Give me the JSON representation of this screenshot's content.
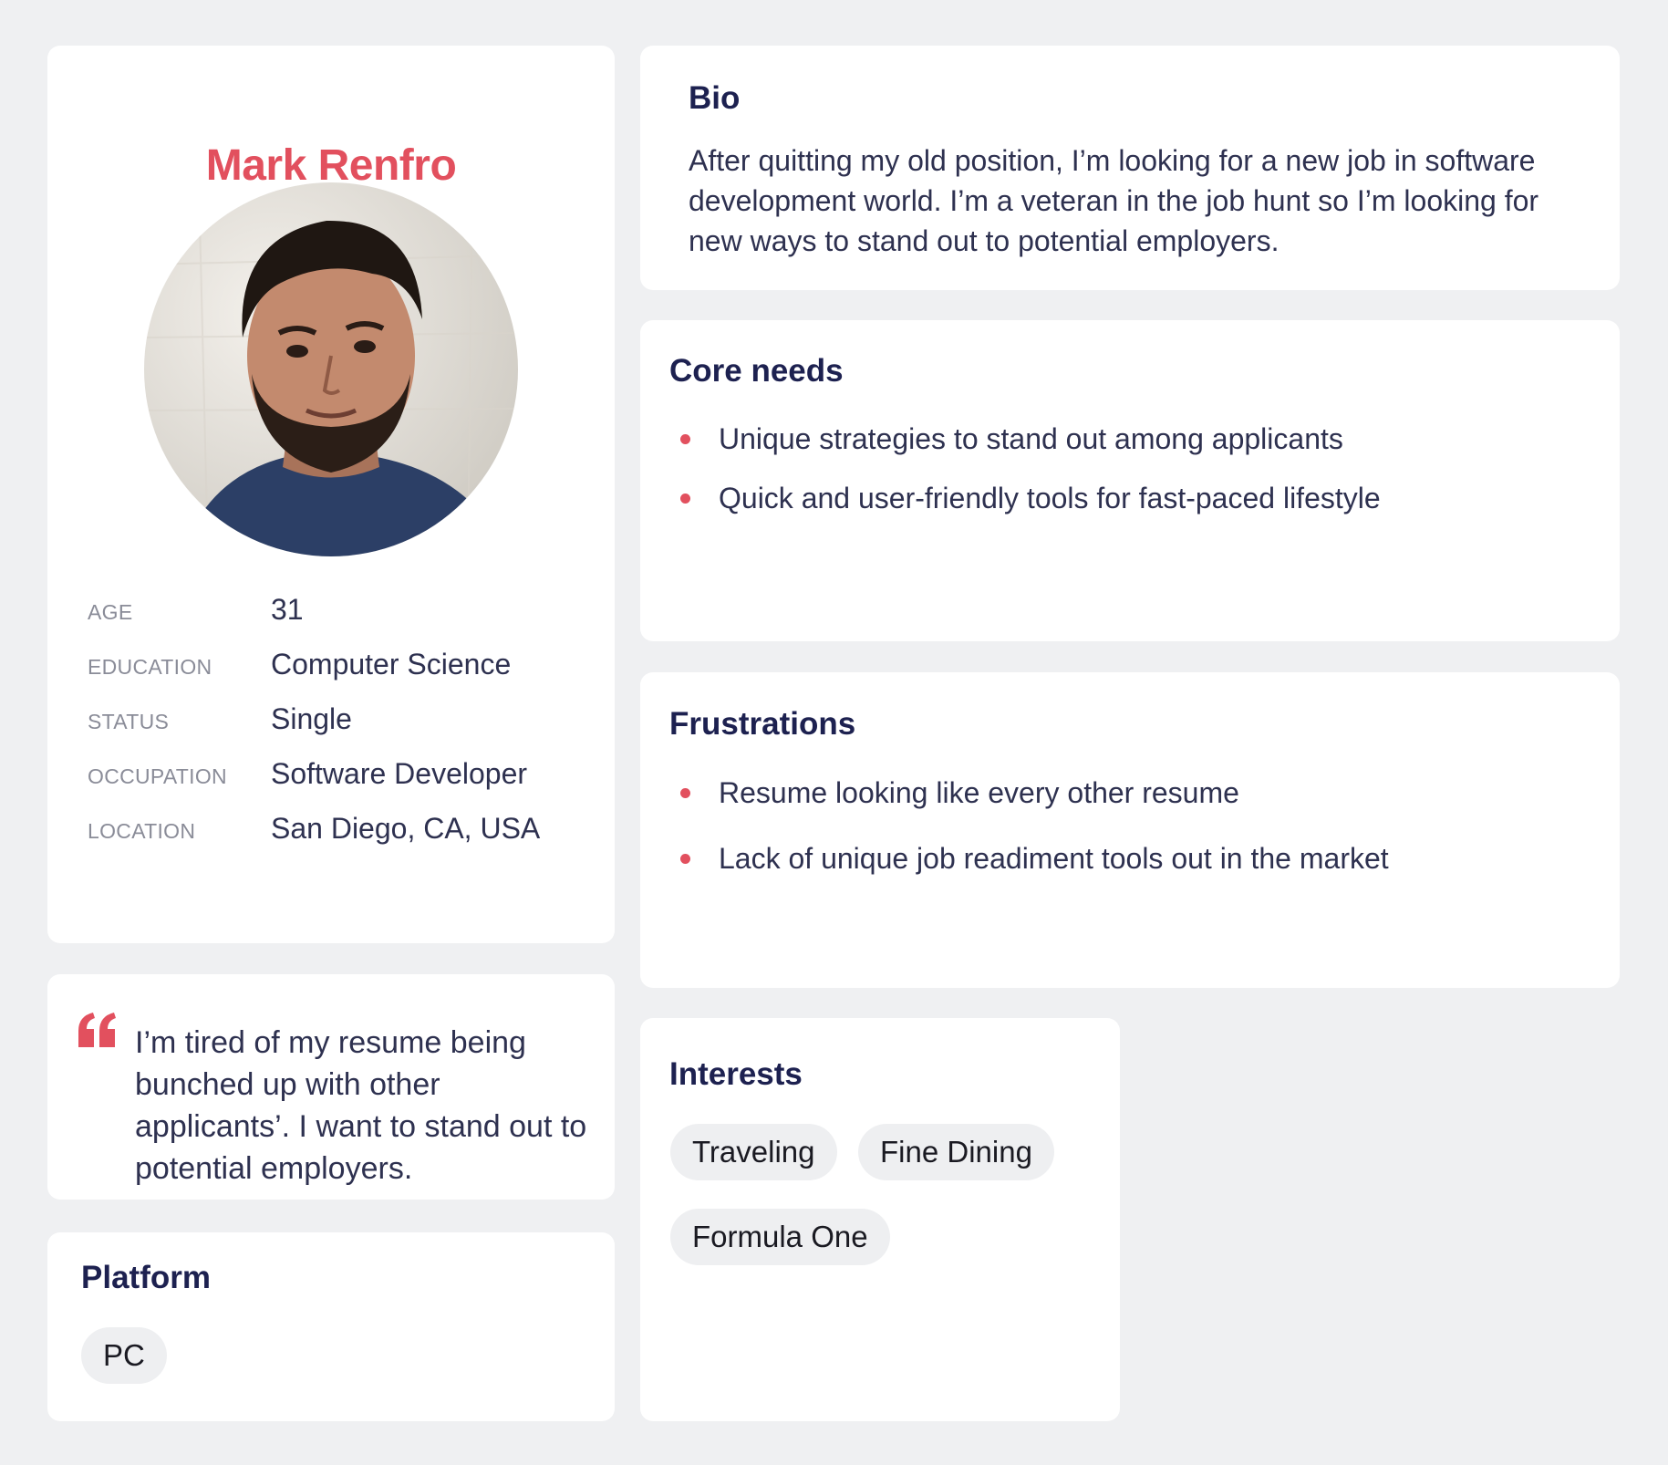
{
  "persona": {
    "name": "Mark Renfro",
    "photo_alt": "avatar",
    "info": [
      {
        "label": "AGE",
        "value": "31"
      },
      {
        "label": "EDUCATION",
        "value": "Computer Science"
      },
      {
        "label": "STATUS",
        "value": "Single"
      },
      {
        "label": "OCCUPATION",
        "value": "Software Developer"
      },
      {
        "label": "LOCATION",
        "value": "San Diego, CA, USA"
      }
    ]
  },
  "quote": {
    "text": "I’m tired of my resume being bunched up with other applicants’. I want to stand out to potential employers."
  },
  "platform": {
    "title": "Platform",
    "items": [
      "PC"
    ]
  },
  "bio": {
    "title": "Bio",
    "text": "After quitting my old position, I’m looking for a new job in software development world. I’m a veteran in the job hunt so I’m looking for new ways to stand out to potential employers."
  },
  "core_needs": {
    "title": "Core needs",
    "items": [
      "Unique strategies to stand out among applicants",
      "Quick and user-friendly tools for fast-paced lifestyle"
    ]
  },
  "frustrations": {
    "title": "Frustrations",
    "items": [
      "Resume looking like every other resume",
      "Lack of unique job readiment tools out in the market"
    ]
  },
  "interests": {
    "title": "Interests",
    "items": [
      "Traveling",
      "Fine Dining",
      "Formula One"
    ]
  },
  "colors": {
    "accent": "#e2505e",
    "heading": "#1d2150",
    "text": "#2e3150",
    "label": "#8a8c98",
    "background": "#eff0f2",
    "chip": "#eeeff1"
  }
}
